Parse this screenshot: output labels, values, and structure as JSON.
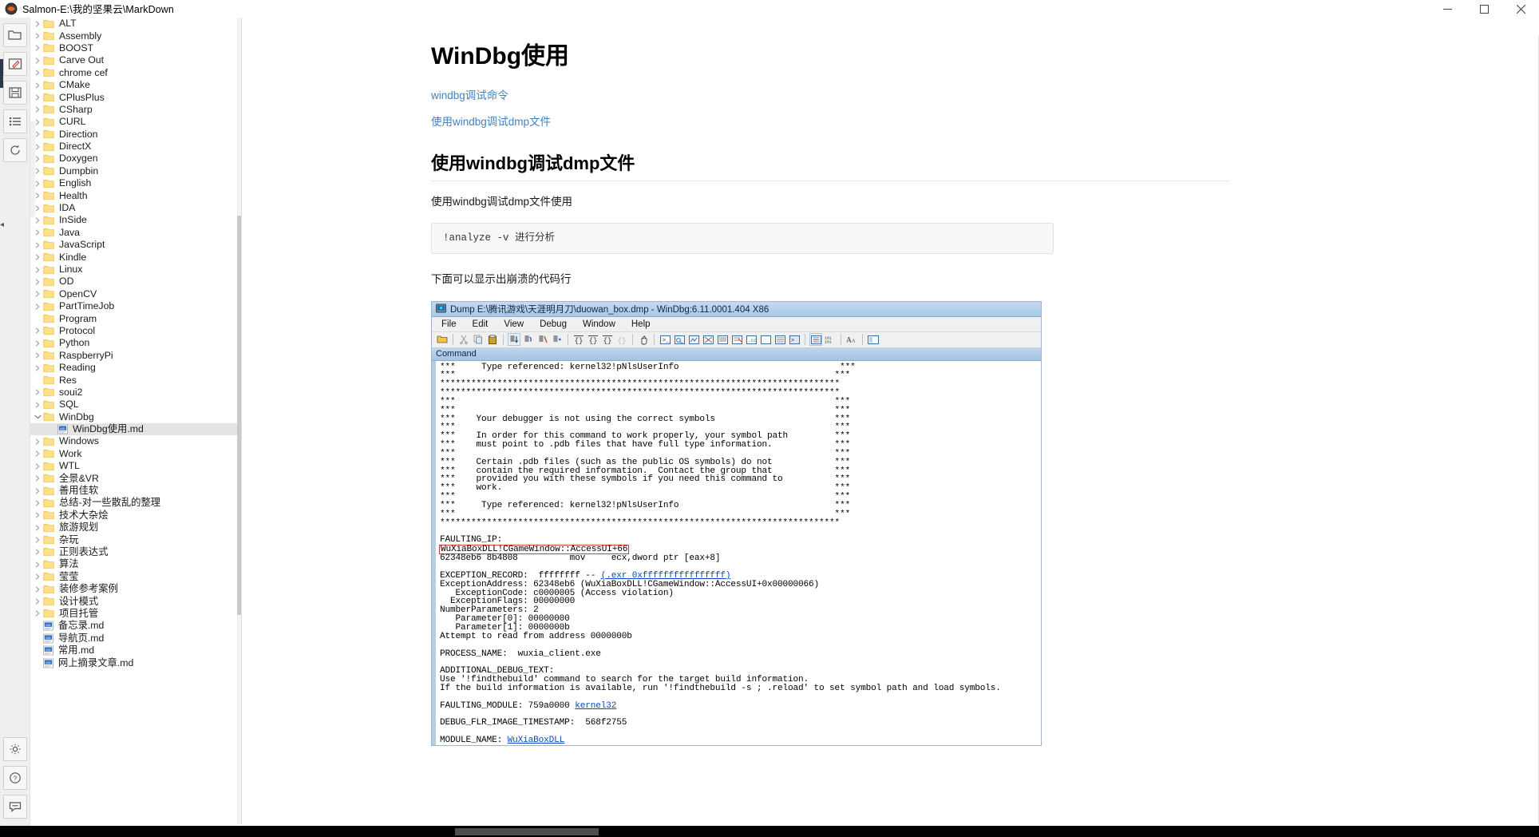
{
  "window": {
    "title": "Salmon-E:\\我的坚果云\\MarkDown",
    "app_icon": "salmon-logo-icon",
    "controls": {
      "minimize": "minimize-icon",
      "maximize": "maximize-icon",
      "close": "close-icon"
    }
  },
  "rail": {
    "buttons": [
      {
        "name": "file-explorer-icon",
        "glyph": "folder"
      },
      {
        "name": "edit-icon",
        "glyph": "pencil"
      },
      {
        "name": "save-icon",
        "glyph": "floppy"
      },
      {
        "name": "outline-icon",
        "glyph": "list"
      },
      {
        "name": "sync-icon",
        "glyph": "refresh"
      }
    ],
    "bottom_buttons": [
      {
        "name": "settings-icon",
        "glyph": "gear"
      },
      {
        "name": "help-icon",
        "glyph": "question"
      },
      {
        "name": "feedback-icon",
        "glyph": "chat"
      }
    ]
  },
  "sidebar": {
    "items": [
      {
        "label": "ALT",
        "type": "folder",
        "expandable": true,
        "expanded": false,
        "indent": 0
      },
      {
        "label": "Assembly",
        "type": "folder",
        "expandable": true,
        "expanded": false,
        "indent": 0
      },
      {
        "label": "BOOST",
        "type": "folder",
        "expandable": true,
        "expanded": false,
        "indent": 0
      },
      {
        "label": "Carve Out",
        "type": "folder",
        "expandable": true,
        "expanded": false,
        "indent": 0
      },
      {
        "label": "chrome cef",
        "type": "folder",
        "expandable": true,
        "expanded": false,
        "indent": 0
      },
      {
        "label": "CMake",
        "type": "folder",
        "expandable": true,
        "expanded": false,
        "indent": 0
      },
      {
        "label": "CPlusPlus",
        "type": "folder",
        "expandable": true,
        "expanded": false,
        "indent": 0
      },
      {
        "label": "CSharp",
        "type": "folder",
        "expandable": true,
        "expanded": false,
        "indent": 0
      },
      {
        "label": "CURL",
        "type": "folder",
        "expandable": true,
        "expanded": false,
        "indent": 0
      },
      {
        "label": "Direction",
        "type": "folder",
        "expandable": true,
        "expanded": false,
        "indent": 0
      },
      {
        "label": "DirectX",
        "type": "folder",
        "expandable": true,
        "expanded": false,
        "indent": 0
      },
      {
        "label": "Doxygen",
        "type": "folder",
        "expandable": true,
        "expanded": false,
        "indent": 0
      },
      {
        "label": "Dumpbin",
        "type": "folder",
        "expandable": true,
        "expanded": false,
        "indent": 0
      },
      {
        "label": "English",
        "type": "folder",
        "expandable": true,
        "expanded": false,
        "indent": 0
      },
      {
        "label": "Health",
        "type": "folder",
        "expandable": true,
        "expanded": false,
        "indent": 0
      },
      {
        "label": "IDA",
        "type": "folder",
        "expandable": true,
        "expanded": false,
        "indent": 0
      },
      {
        "label": "InSide",
        "type": "folder",
        "expandable": true,
        "expanded": false,
        "indent": 0
      },
      {
        "label": "Java",
        "type": "folder",
        "expandable": true,
        "expanded": false,
        "indent": 0
      },
      {
        "label": "JavaScript",
        "type": "folder",
        "expandable": true,
        "expanded": false,
        "indent": 0
      },
      {
        "label": "Kindle",
        "type": "folder",
        "expandable": true,
        "expanded": false,
        "indent": 0
      },
      {
        "label": "Linux",
        "type": "folder",
        "expandable": true,
        "expanded": false,
        "indent": 0
      },
      {
        "label": "OD",
        "type": "folder",
        "expandable": true,
        "expanded": false,
        "indent": 0
      },
      {
        "label": "OpenCV",
        "type": "folder",
        "expandable": true,
        "expanded": false,
        "indent": 0
      },
      {
        "label": "PartTimeJob",
        "type": "folder",
        "expandable": true,
        "expanded": false,
        "indent": 0
      },
      {
        "label": "Program",
        "type": "folder",
        "expandable": false,
        "expanded": false,
        "indent": 0
      },
      {
        "label": "Protocol",
        "type": "folder",
        "expandable": true,
        "expanded": false,
        "indent": 0
      },
      {
        "label": "Python",
        "type": "folder",
        "expandable": true,
        "expanded": false,
        "indent": 0
      },
      {
        "label": "RaspberryPi",
        "type": "folder",
        "expandable": true,
        "expanded": false,
        "indent": 0
      },
      {
        "label": "Reading",
        "type": "folder",
        "expandable": true,
        "expanded": false,
        "indent": 0
      },
      {
        "label": "Res",
        "type": "folder",
        "expandable": false,
        "expanded": false,
        "indent": 0
      },
      {
        "label": "soui2",
        "type": "folder",
        "expandable": true,
        "expanded": false,
        "indent": 0
      },
      {
        "label": "SQL",
        "type": "folder",
        "expandable": true,
        "expanded": false,
        "indent": 0
      },
      {
        "label": "WinDbg",
        "type": "folder",
        "expandable": true,
        "expanded": true,
        "indent": 0
      },
      {
        "label": "WinDbg使用.md",
        "type": "markdown",
        "expandable": false,
        "expanded": false,
        "indent": 1,
        "selected": true
      },
      {
        "label": "Windows",
        "type": "folder",
        "expandable": true,
        "expanded": false,
        "indent": 0
      },
      {
        "label": "Work",
        "type": "folder",
        "expandable": true,
        "expanded": false,
        "indent": 0
      },
      {
        "label": "WTL",
        "type": "folder",
        "expandable": true,
        "expanded": false,
        "indent": 0
      },
      {
        "label": "全景&VR",
        "type": "folder",
        "expandable": true,
        "expanded": false,
        "indent": 0
      },
      {
        "label": "善用佳软",
        "type": "folder",
        "expandable": true,
        "expanded": false,
        "indent": 0
      },
      {
        "label": "总结-对一些散乱的整理",
        "type": "folder",
        "expandable": true,
        "expanded": false,
        "indent": 0
      },
      {
        "label": "技术大杂烩",
        "type": "folder",
        "expandable": true,
        "expanded": false,
        "indent": 0
      },
      {
        "label": "旅游规划",
        "type": "folder",
        "expandable": true,
        "expanded": false,
        "indent": 0
      },
      {
        "label": "杂玩",
        "type": "folder",
        "expandable": true,
        "expanded": false,
        "indent": 0
      },
      {
        "label": "正则表达式",
        "type": "folder",
        "expandable": true,
        "expanded": false,
        "indent": 0
      },
      {
        "label": "算法",
        "type": "folder",
        "expandable": true,
        "expanded": false,
        "indent": 0
      },
      {
        "label": "莹莹",
        "type": "folder",
        "expandable": true,
        "expanded": false,
        "indent": 0
      },
      {
        "label": "装修参考案例",
        "type": "folder",
        "expandable": true,
        "expanded": false,
        "indent": 0
      },
      {
        "label": "设计模式",
        "type": "folder",
        "expandable": true,
        "expanded": false,
        "indent": 0
      },
      {
        "label": "项目托管",
        "type": "folder",
        "expandable": true,
        "expanded": false,
        "indent": 0
      },
      {
        "label": "备忘录.md",
        "type": "markdown",
        "expandable": false,
        "expanded": false,
        "indent": 0
      },
      {
        "label": "导航页.md",
        "type": "markdown",
        "expandable": false,
        "expanded": false,
        "indent": 0
      },
      {
        "label": "常用.md",
        "type": "markdown",
        "expandable": false,
        "expanded": false,
        "indent": 0
      },
      {
        "label": "网上摘录文章.md",
        "type": "markdown",
        "expandable": false,
        "expanded": false,
        "indent": 0
      }
    ]
  },
  "document": {
    "h1": "WinDbg使用",
    "toc": [
      "windbg调试命令",
      "使用windbg调试dmp文件"
    ],
    "h2": "使用windbg调试dmp文件",
    "paragraph1": "使用windbg调试dmp文件使用",
    "code1": "!analyze -v 进行分析",
    "paragraph2": "下面可以显示出崩溃的代码行"
  },
  "windbg_image": {
    "title": "Dump E:\\腾讯游戏\\天涯明月刀\\duowan_box.dmp - WinDbg:6.11.0001.404 X86",
    "title_icon": "windbg-app-icon",
    "menu": [
      "File",
      "Edit",
      "View",
      "Debug",
      "Window",
      "Help"
    ],
    "toolbar_icons": [
      "open-folder-icon",
      "cut-icon",
      "copy-icon",
      "paste-icon",
      "step-into-icon",
      "step-over-icon",
      "step-out-icon",
      "run-to-cursor-icon",
      "open-brace-icon",
      "close-brace-icon",
      "braces-icon",
      "braces-disabled-icon",
      "break-hand-icon",
      "command-window-icon",
      "watch-window-icon",
      "locals-window-icon",
      "registers-window-icon",
      "memory-window-icon",
      "calls-window-icon",
      "disassembly-window-icon",
      "scratch-pad-icon",
      "processes-icon",
      "command-browser-icon",
      "source-window-icon",
      "line-numbers-icon"
    ],
    "panel_title": "Command",
    "console_lines": [
      "***     Type referenced: kernel32!pNlsUserInfo                               ***",
      "***                                                                         ***",
      "*****************************************************************************",
      "*****************************************************************************",
      "***                                                                         ***",
      "***                                                                         ***",
      "***    Your debugger is not using the correct symbols                       ***",
      "***                                                                         ***",
      "***    In order for this command to work properly, your symbol path         ***",
      "***    must point to .pdb files that have full type information.            ***",
      "***                                                                         ***",
      "***    Certain .pdb files (such as the public OS symbols) do not            ***",
      "***    contain the required information.  Contact the group that            ***",
      "***    provided you with these symbols if you need this command to          ***",
      "***    work.                                                                ***",
      "***                                                                         ***",
      "***     Type referenced: kernel32!pNlsUserInfo                              ***",
      "***                                                                         ***",
      "*****************************************************************************",
      "",
      "FAULTING_IP:",
      "__BOXED__WuXiaBoxDLL!CGameWindow::AccessUI+66",
      "62348eb6 8b4808          mov     ecx,dword ptr [eax+8]",
      "",
      "__LINK__EXCEPTION_RECORD:  ffffffff -- |(.exr 0xffffffffffffffff)",
      "ExceptionAddress: 62348eb6 (WuXiaBoxDLL!CGameWindow::AccessUI+0x00000066)",
      "   ExceptionCode: c0000005 (Access violation)",
      "  ExceptionFlags: 00000000",
      "NumberParameters: 2",
      "   Parameter[0]: 00000000",
      "   Parameter[1]: 0000000b",
      "Attempt to read from address 0000000b",
      "",
      "PROCESS_NAME:  wuxia_client.exe",
      "",
      "ADDITIONAL_DEBUG_TEXT:",
      "Use '!findthebuild' command to search for the target build information.",
      "If the build information is available, run '!findthebuild -s ; .reload' to set symbol path and load symbols.",
      "",
      "__LINK2__FAULTING_MODULE: 759a0000 |kernel32",
      "",
      "DEBUG_FLR_IMAGE_TIMESTAMP:  568f2755",
      "",
      "__LINK2__MODULE_NAME: |WuXiaBoxDLL"
    ]
  },
  "colors": {
    "link": "#4183c4",
    "windbg_link": "#0b48c8",
    "highlight_box": "#d83b3b",
    "selection": "#e4e4e4",
    "folder": "#f7d57a"
  }
}
